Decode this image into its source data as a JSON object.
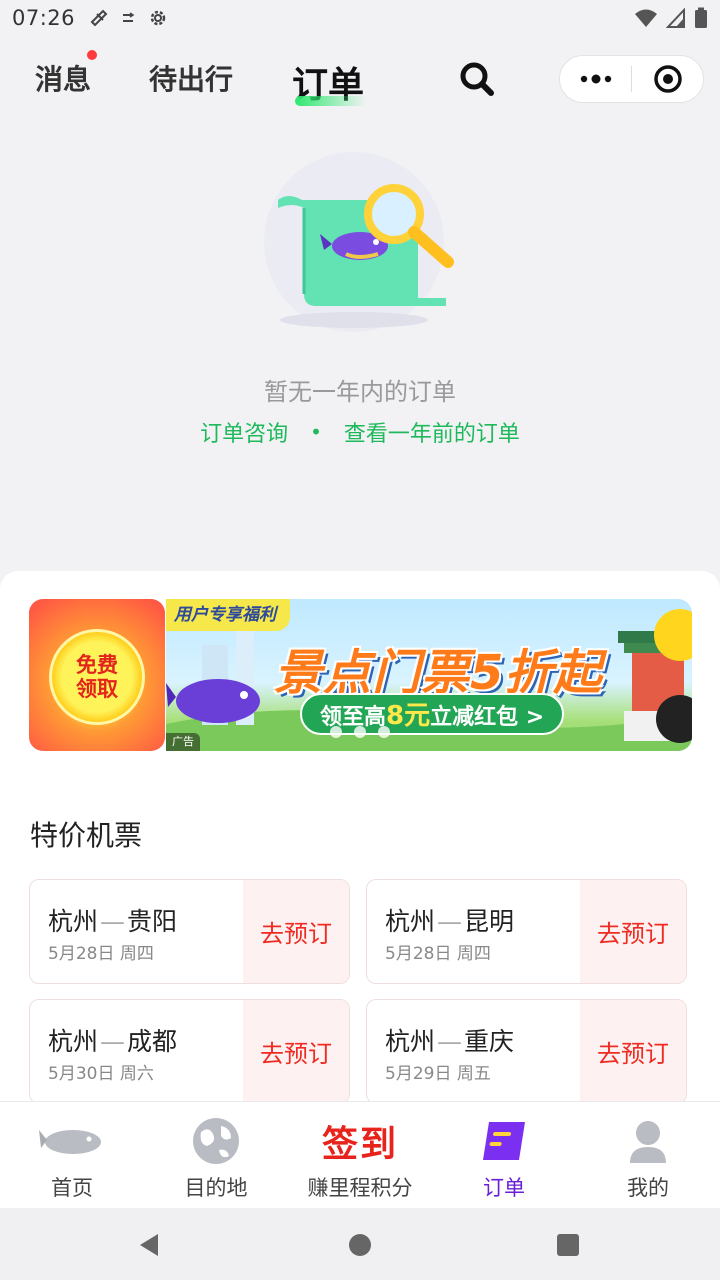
{
  "status_bar": {
    "time": "07:26"
  },
  "header": {
    "tabs": [
      {
        "label": "消息",
        "has_dot": true
      },
      {
        "label": "待出行"
      },
      {
        "label": "订单",
        "active": true
      }
    ],
    "accent_color": "#2ee86f"
  },
  "empty_state": {
    "message": "暂无一年内的订单",
    "link_consult": "订单咨询",
    "separator": "•",
    "link_history": "查看一年前的订单"
  },
  "promo": {
    "left_card_line1": "免费",
    "left_card_line2": "领取",
    "banner_tag": "用户专享福利",
    "banner_title": "景点门票5折起",
    "banner_pill_pre": "领至高",
    "banner_pill_amount": "8元",
    "banner_pill_post": "立减红包 >",
    "ad_label": "广告"
  },
  "flights": {
    "section_title": "特价机票",
    "book_label": "去预订",
    "items": [
      {
        "from": "杭州",
        "dash": "—",
        "to": "贵阳",
        "date": "5月28日 周四"
      },
      {
        "from": "杭州",
        "dash": "—",
        "to": "昆明",
        "date": "5月28日 周四"
      },
      {
        "from": "杭州",
        "dash": "—",
        "to": "成都",
        "date": "5月30日 周六"
      },
      {
        "from": "杭州",
        "dash": "—",
        "to": "重庆",
        "date": "5月29日 周五"
      }
    ]
  },
  "bottom_nav": {
    "items": [
      {
        "label": "首页",
        "icon": "home-whale-icon"
      },
      {
        "label": "目的地",
        "icon": "globe-icon"
      },
      {
        "label": "赚里程积分",
        "icon": "signin-icon",
        "icon_text": "签到"
      },
      {
        "label": "订单",
        "icon": "orders-icon",
        "active": true
      },
      {
        "label": "我的",
        "icon": "user-icon"
      }
    ],
    "active_color": "#6a1fd6"
  }
}
